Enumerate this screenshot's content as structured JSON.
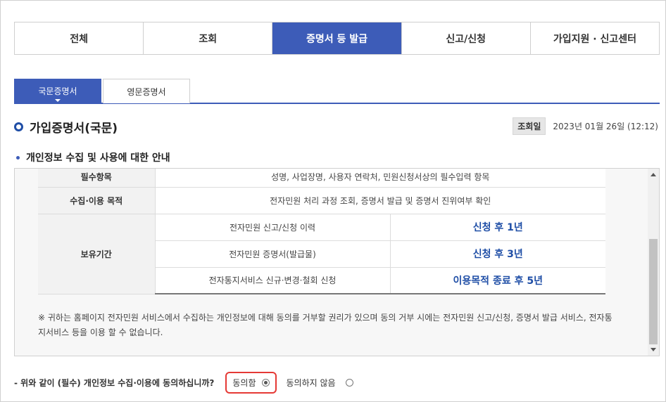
{
  "main_tabs": [
    {
      "label": "전체"
    },
    {
      "label": "조회"
    },
    {
      "label": "증명서 등 발급"
    },
    {
      "label": "신고/신청"
    },
    {
      "label": "가입지원 · 신고센터"
    }
  ],
  "sub_tabs": [
    {
      "label": "국문증명서"
    },
    {
      "label": "영문증명서"
    }
  ],
  "page_title": "가입증명서(국문)",
  "query": {
    "label": "조회일",
    "value": "2023년 01월 26일 (12:12)"
  },
  "section_heading": "개인정보 수집 및 사용에 대한 안내",
  "table": {
    "required_header": "필수항목",
    "required_value": "성명, 사업장명, 사용자 연락처, 민원신청서상의 필수입력 항목",
    "purpose_header": "수집·이용 목적",
    "purpose_value": "전자민원 처리 과정 조회, 증명서 발급 및 증명서 진위여부 확인",
    "retention_header": "보유기간",
    "retention_rows": [
      {
        "item": "전자민원 신고/신청 이력",
        "period": "신청 후 1년"
      },
      {
        "item": "전자민원 증명서(발급물)",
        "period": "신청 후 3년"
      },
      {
        "item": "전자통지서비스 신규·변경·철회 신청",
        "period": "이용목적 종료 후 5년"
      }
    ]
  },
  "notice": "※ 귀하는 홈페이지 전자민원 서비스에서 수집하는 개인정보에 대해 동의를 거부할 권리가 있으며 동의 거부 시에는 전자민원 신고/신청, 증명서 발급 서비스, 전자통지서비스 등을 이용 할 수 없습니다.",
  "consent": {
    "question": "- 위와 같이 (필수) 개인정보 수집·이용에 동의하십니까?",
    "agree_label": "동의함",
    "disagree_label": "동의하지 않음",
    "selected": "agree"
  },
  "colors": {
    "accent": "#3d5cb8",
    "highlight_border": "#e53935",
    "period_text": "#1f4ea6"
  }
}
